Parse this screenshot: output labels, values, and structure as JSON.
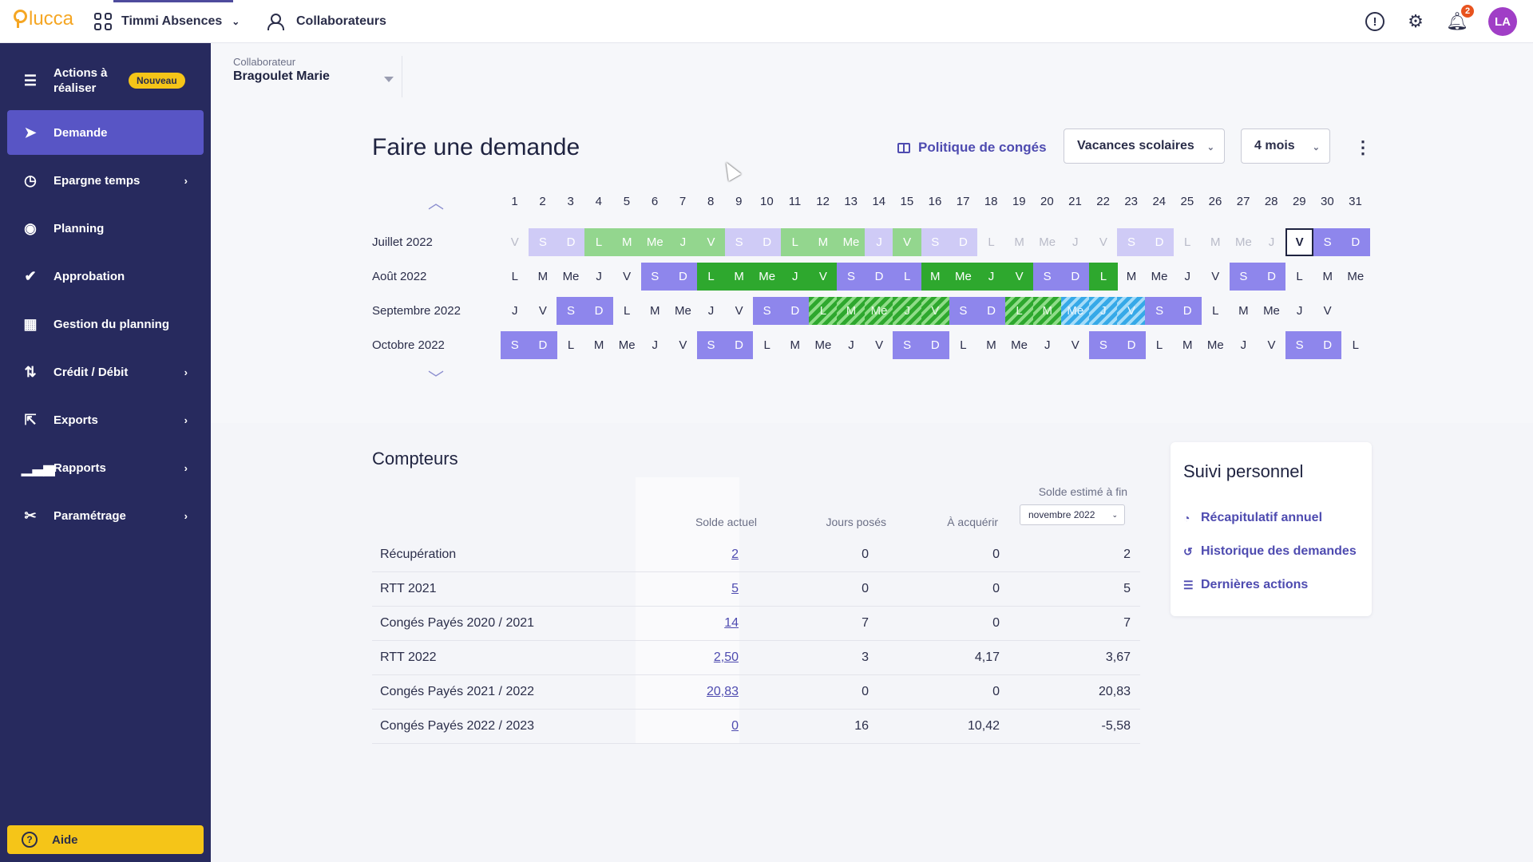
{
  "topbar": {
    "logo": "lucca",
    "app_name": "Timmi Absences",
    "collaborateurs": "Collaborateurs",
    "notif_count": "2",
    "avatar_initials": "LA"
  },
  "sidebar": {
    "items": [
      {
        "label": "Actions à réaliser",
        "badge": "Nouveau"
      },
      {
        "label": "Demande"
      },
      {
        "label": "Epargne temps"
      },
      {
        "label": "Planning"
      },
      {
        "label": "Approbation"
      },
      {
        "label": "Gestion du planning"
      },
      {
        "label": "Crédit / Débit"
      },
      {
        "label": "Exports"
      },
      {
        "label": "Rapports"
      },
      {
        "label": "Paramétrage"
      }
    ],
    "aide": "Aide"
  },
  "collaborator": {
    "label": "Collaborateur",
    "value": "Bragoulet Marie"
  },
  "request": {
    "title": "Faire une demande",
    "policy_link": "Politique de congés",
    "holidays_select": "Vacances scolaires",
    "period_select": "4 mois"
  },
  "calendar": {
    "day_numbers": [
      "1",
      "2",
      "3",
      "4",
      "5",
      "6",
      "7",
      "8",
      "9",
      "10",
      "11",
      "12",
      "13",
      "14",
      "15",
      "16",
      "17",
      "18",
      "19",
      "20",
      "21",
      "22",
      "23",
      "24",
      "25",
      "26",
      "27",
      "28",
      "29",
      "30",
      "31"
    ],
    "months": [
      {
        "name": "Juillet 2022",
        "days": [
          [
            "V",
            "faded"
          ],
          [
            "S",
            "we-f"
          ],
          [
            "D",
            "we-f"
          ],
          [
            "L",
            "green-f"
          ],
          [
            "M",
            "green-f"
          ],
          [
            "Me",
            "green-f"
          ],
          [
            "J",
            "green-f"
          ],
          [
            "V",
            "green-f"
          ],
          [
            "S",
            "we-f"
          ],
          [
            "D",
            "we-f"
          ],
          [
            "L",
            "green-f"
          ],
          [
            "M",
            "green-f"
          ],
          [
            "Me",
            "green-f"
          ],
          [
            "J",
            "we-f"
          ],
          [
            "V",
            "green-f"
          ],
          [
            "S",
            "we-f"
          ],
          [
            "D",
            "we-f"
          ],
          [
            "L",
            "faded"
          ],
          [
            "M",
            "faded"
          ],
          [
            "Me",
            "faded"
          ],
          [
            "J",
            "faded"
          ],
          [
            "V",
            "faded"
          ],
          [
            "S",
            "we-f"
          ],
          [
            "D",
            "we-f"
          ],
          [
            "L",
            "faded"
          ],
          [
            "M",
            "faded"
          ],
          [
            "Me",
            "faded"
          ],
          [
            "J",
            "faded"
          ],
          [
            "V",
            "today"
          ],
          [
            "S",
            "we"
          ],
          [
            "D",
            "we"
          ]
        ]
      },
      {
        "name": "Août 2022",
        "days": [
          [
            "L",
            "normal"
          ],
          [
            "M",
            "normal"
          ],
          [
            "Me",
            "normal"
          ],
          [
            "J",
            "normal"
          ],
          [
            "V",
            "normal"
          ],
          [
            "S",
            "we"
          ],
          [
            "D",
            "we"
          ],
          [
            "L",
            "green"
          ],
          [
            "M",
            "green"
          ],
          [
            "Me",
            "green"
          ],
          [
            "J",
            "green"
          ],
          [
            "V",
            "green"
          ],
          [
            "S",
            "we"
          ],
          [
            "D",
            "we"
          ],
          [
            "L",
            "we"
          ],
          [
            "M",
            "green"
          ],
          [
            "Me",
            "green"
          ],
          [
            "J",
            "green"
          ],
          [
            "V",
            "green"
          ],
          [
            "S",
            "we"
          ],
          [
            "D",
            "we"
          ],
          [
            "L",
            "green"
          ],
          [
            "M",
            "normal"
          ],
          [
            "Me",
            "normal"
          ],
          [
            "J",
            "normal"
          ],
          [
            "V",
            "normal"
          ],
          [
            "S",
            "we"
          ],
          [
            "D",
            "we"
          ],
          [
            "L",
            "normal"
          ],
          [
            "M",
            "normal"
          ],
          [
            "Me",
            "normal"
          ]
        ]
      },
      {
        "name": "Septembre 2022",
        "days": [
          [
            "J",
            "normal"
          ],
          [
            "V",
            "normal"
          ],
          [
            "S",
            "we"
          ],
          [
            "D",
            "we"
          ],
          [
            "L",
            "normal"
          ],
          [
            "M",
            "normal"
          ],
          [
            "Me",
            "normal"
          ],
          [
            "J",
            "normal"
          ],
          [
            "V",
            "normal"
          ],
          [
            "S",
            "we"
          ],
          [
            "D",
            "we"
          ],
          [
            "L",
            "gstripe"
          ],
          [
            "M",
            "gstripe"
          ],
          [
            "Me",
            "gstripe"
          ],
          [
            "J",
            "gstripe"
          ],
          [
            "V",
            "gstripe"
          ],
          [
            "S",
            "we"
          ],
          [
            "D",
            "we"
          ],
          [
            "L",
            "gstripe"
          ],
          [
            "M",
            "gstripe"
          ],
          [
            "Me",
            "bstripe"
          ],
          [
            "J",
            "bstripe"
          ],
          [
            "V",
            "bstripe"
          ],
          [
            "S",
            "we"
          ],
          [
            "D",
            "we"
          ],
          [
            "L",
            "normal"
          ],
          [
            "M",
            "normal"
          ],
          [
            "Me",
            "normal"
          ],
          [
            "J",
            "normal"
          ],
          [
            "V",
            "normal"
          ]
        ]
      },
      {
        "name": "Octobre 2022",
        "days": [
          [
            "S",
            "we"
          ],
          [
            "D",
            "we"
          ],
          [
            "L",
            "normal"
          ],
          [
            "M",
            "normal"
          ],
          [
            "Me",
            "normal"
          ],
          [
            "J",
            "normal"
          ],
          [
            "V",
            "normal"
          ],
          [
            "S",
            "we"
          ],
          [
            "D",
            "we"
          ],
          [
            "L",
            "normal"
          ],
          [
            "M",
            "normal"
          ],
          [
            "Me",
            "normal"
          ],
          [
            "J",
            "normal"
          ],
          [
            "V",
            "normal"
          ],
          [
            "S",
            "we"
          ],
          [
            "D",
            "we"
          ],
          [
            "L",
            "normal"
          ],
          [
            "M",
            "normal"
          ],
          [
            "Me",
            "normal"
          ],
          [
            "J",
            "normal"
          ],
          [
            "V",
            "normal"
          ],
          [
            "S",
            "we"
          ],
          [
            "D",
            "we"
          ],
          [
            "L",
            "normal"
          ],
          [
            "M",
            "normal"
          ],
          [
            "Me",
            "normal"
          ],
          [
            "J",
            "normal"
          ],
          [
            "V",
            "normal"
          ],
          [
            "S",
            "we"
          ],
          [
            "D",
            "we"
          ],
          [
            "L",
            "normal"
          ]
        ]
      }
    ]
  },
  "counters": {
    "title": "Compteurs",
    "headers": {
      "solde": "Solde actuel",
      "poses": "Jours posés",
      "acquerir": "À acquérir",
      "fin": "Solde estimé à fin"
    },
    "fin_select": "novembre 2022",
    "rows": [
      {
        "name": "Récupération",
        "solde": "2",
        "poses": "0",
        "acquerir": "0",
        "fin": "2"
      },
      {
        "name": "RTT 2021",
        "solde": "5",
        "poses": "0",
        "acquerir": "0",
        "fin": "5"
      },
      {
        "name": "Congés Payés 2020 / 2021",
        "solde": "14",
        "poses": "7",
        "acquerir": "0",
        "fin": "7"
      },
      {
        "name": "RTT 2022",
        "solde": "2,50",
        "poses": "3",
        "acquerir": "4,17",
        "fin": "3,67"
      },
      {
        "name": "Congés Payés 2021 / 2022",
        "solde": "20,83",
        "poses": "0",
        "acquerir": "0",
        "fin": "20,83"
      },
      {
        "name": "Congés Payés 2022 / 2023",
        "solde": "0",
        "poses": "16",
        "acquerir": "10,42",
        "fin": "-5,58"
      }
    ]
  },
  "suivi": {
    "title": "Suivi personnel",
    "links": [
      "Récapitulatif annuel",
      "Historique des demandes",
      "Dernières actions"
    ]
  }
}
